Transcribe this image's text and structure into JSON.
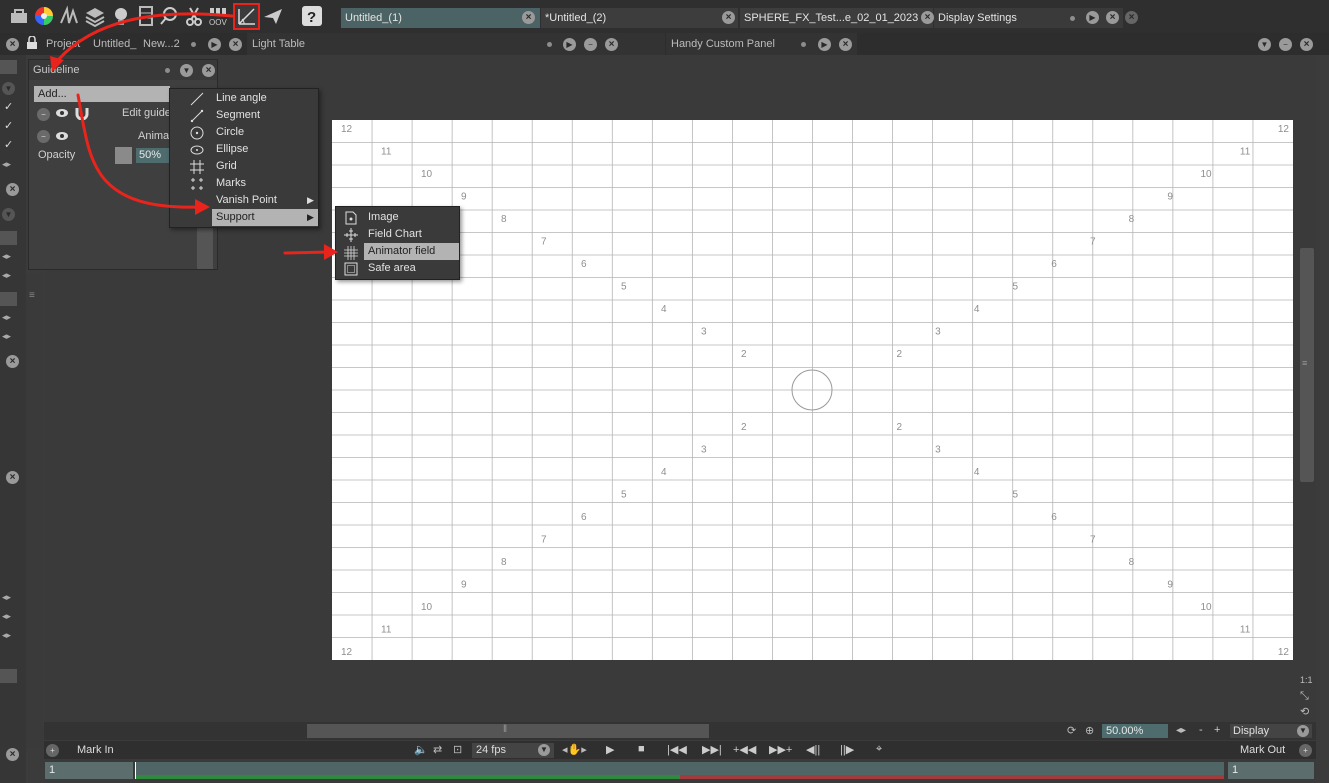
{
  "toolbar": {
    "tools": [
      "toolbox-icon",
      "color-wheel-icon",
      "brush-icon",
      "layers-icon",
      "light-bulb-icon",
      "xsheet-icon",
      "search-icon",
      "scissors-icon",
      "camera-icon",
      "guideline-tool-icon",
      "paper-plane-icon",
      "help-icon"
    ],
    "tabs": [
      {
        "label": "Untitled_(1)"
      },
      {
        "label": "*Untitled_(2)"
      },
      {
        "label": "SPHERE_FX_Test...e_02_01_2023"
      },
      {
        "label": "Display Settings"
      }
    ]
  },
  "panels": {
    "project_tabs": [
      "Project",
      "Untitled_",
      "New...2"
    ],
    "light_table": "Light Table",
    "handy_custom": "Handy Custom Panel"
  },
  "guideline": {
    "title": "Guideline",
    "add_button": "Add...",
    "rows": [
      {
        "label": "Edit guide"
      },
      {
        "label": "Anima"
      }
    ],
    "opacity_label": "Opacity",
    "opacity_value": "50%"
  },
  "add_menu": {
    "items": [
      {
        "label": "Line angle",
        "icon": "line-angle-icon"
      },
      {
        "label": "Segment",
        "icon": "segment-icon"
      },
      {
        "label": "Circle",
        "icon": "circle-icon"
      },
      {
        "label": "Ellipse",
        "icon": "ellipse-icon"
      },
      {
        "label": "Grid",
        "icon": "grid-icon"
      },
      {
        "label": "Marks",
        "icon": "marks-icon"
      },
      {
        "label": "Vanish Point",
        "icon": ""
      },
      {
        "label": "Support",
        "icon": ""
      }
    ]
  },
  "support_menu": {
    "items": [
      {
        "label": "Image",
        "icon": "image-icon"
      },
      {
        "label": "Field Chart",
        "icon": "field-chart-icon"
      },
      {
        "label": "Animator field",
        "icon": "animator-field-icon"
      },
      {
        "label": "Safe area",
        "icon": "safe-area-icon"
      }
    ]
  },
  "field_labels": {
    "top": [
      "12",
      "11",
      "10",
      "9",
      "8",
      "7",
      "6",
      "5",
      "4",
      "3",
      "2"
    ],
    "corner": "12"
  },
  "viewbar": {
    "zoom": "50.00%",
    "display": "Display",
    "minus": "-",
    "plus": "+"
  },
  "timeline": {
    "mark_in": "Mark In",
    "mark_out": "Mark Out",
    "fps": "24 fps",
    "in_frame": "1",
    "out_frame": "1"
  },
  "colors": {
    "accent_red": "#e8241c",
    "track_green": "#2f8a3e",
    "track_red": "#a23b3b",
    "highlight": "#b3b3b3"
  }
}
